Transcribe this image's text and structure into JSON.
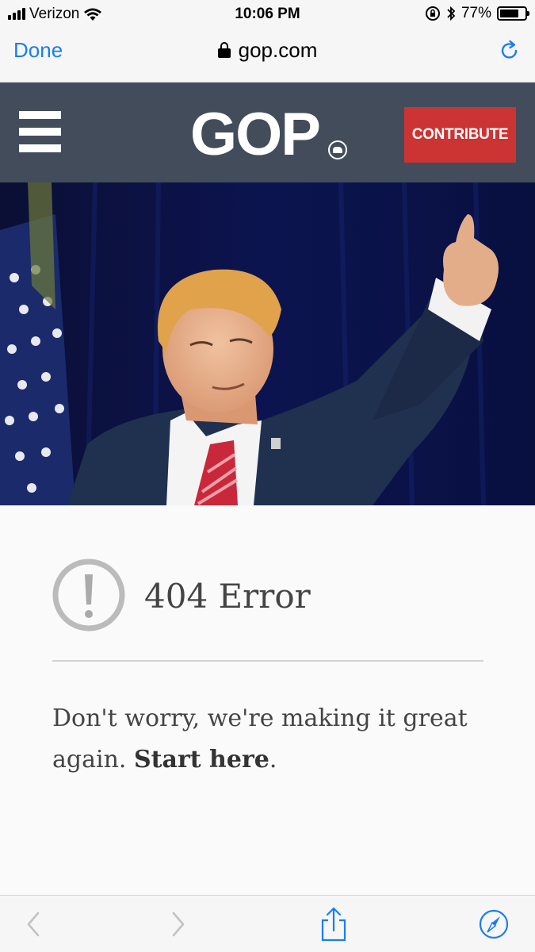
{
  "status_bar": {
    "carrier": "Verizon",
    "time": "10:06 PM",
    "battery_percent": "77%",
    "battery_level": 0.77
  },
  "browser": {
    "done_label": "Done",
    "url": "gop.com"
  },
  "header": {
    "logo_text": "GOP",
    "contribute_label": "CONTRIBUTE",
    "accent_color": "#cc3333",
    "header_color": "#434c5a"
  },
  "error": {
    "title": "404 Error",
    "message_prefix": "Don't worry, we're making it great again.",
    "link_text": "Start here",
    "message_suffix": "."
  },
  "icons": [
    "hamburger-icon",
    "lock-icon",
    "reload-icon",
    "alert-icon",
    "back-icon",
    "forward-icon",
    "share-icon",
    "compass-icon"
  ]
}
